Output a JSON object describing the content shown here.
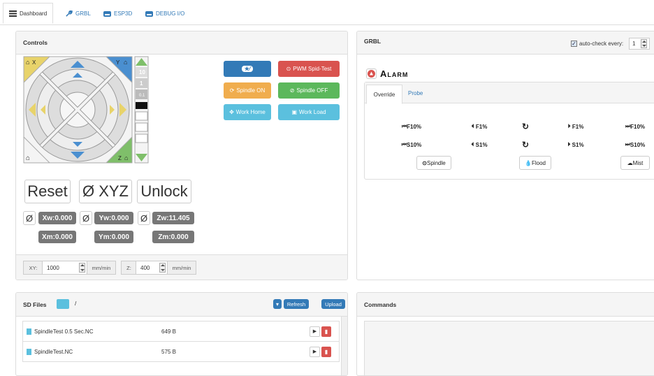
{
  "tabs": [
    {
      "label": "Dashboard",
      "icon": "dashboard-icon"
    },
    {
      "label": "GRBL",
      "icon": "wrench-icon"
    },
    {
      "label": "ESP3D",
      "icon": "drive-icon"
    },
    {
      "label": "DEBUG I/O",
      "icon": "drive-icon"
    }
  ],
  "controls": {
    "title": "Controls",
    "jog": {
      "x_minus": "X",
      "y_plus": "Y",
      "z_plus": "Z",
      "home": "",
      "z_steps": [
        "10",
        "1",
        "0.1"
      ]
    },
    "buttons": {
      "pwm_test": "PWM Spid-Test",
      "spindle_on": "Spindle ON",
      "spindle_off": "Spindle OFF",
      "work_home": "Work Home",
      "work_load": "Work Load"
    },
    "reset": "Reset",
    "zero_xyz": "Ø XYZ",
    "unlock": "Unlock",
    "zero_symbol": "Ø",
    "xw": "Xw:0.000",
    "yw": "Yw:0.000",
    "zw": "Zw:11.405",
    "xm": "Xm:0.000",
    "ym": "Ym:0.000",
    "zm": "Zm:0.000",
    "feed": {
      "xy_label": "XY:",
      "xy_value": "1000",
      "xy_unit": "mm/min",
      "z_label": "Z:",
      "z_value": "400",
      "z_unit": "mm/min"
    }
  },
  "grbl": {
    "title": "GRBL",
    "autocheck_label": "auto-check every:",
    "autocheck_value": "1",
    "status": "Alarm",
    "tabs": [
      "Override",
      "Probe"
    ],
    "overrides": {
      "f_minus10": "F10%",
      "f_minus1": "F1%",
      "f_plus1": "F1%",
      "f_plus10": "F10%",
      "s_minus10": "S10%",
      "s_minus1": "S1%",
      "s_plus1": "S1%",
      "s_plus10": "S10%",
      "spindle": "Spindle",
      "flood": "Flood",
      "mist": "Mist"
    }
  },
  "sd": {
    "title": "SD Files",
    "path": "/",
    "refresh": "Refresh",
    "upload": "Upload",
    "files": [
      {
        "name": "SpindleTest 0.5 Sec.NC",
        "size": "649 B"
      },
      {
        "name": "SpindleTest.NC",
        "size": "575 B"
      }
    ]
  },
  "commands": {
    "title": "Commands"
  }
}
